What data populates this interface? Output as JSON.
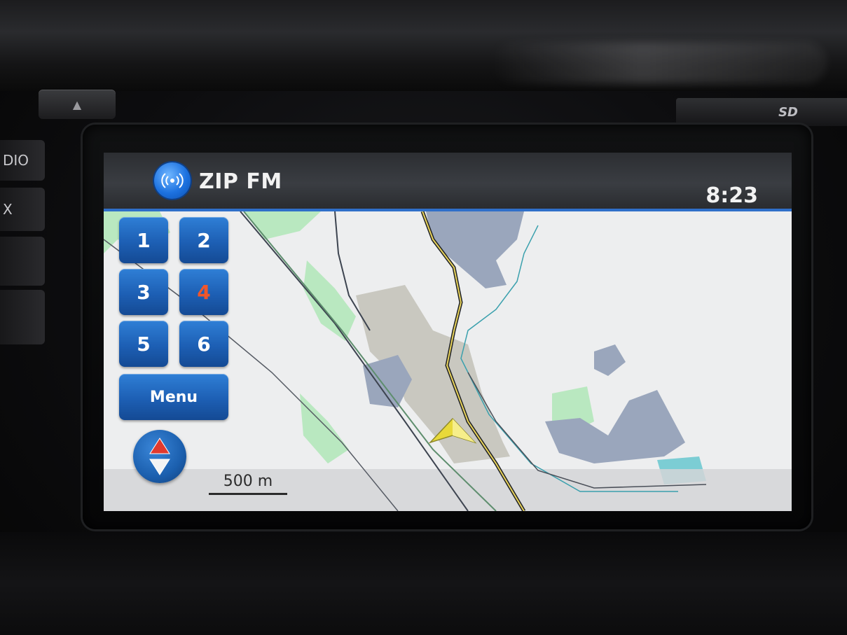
{
  "colors": {
    "accent_blue": "#2f6fc9",
    "preset_button": "#1d5fb4",
    "active_preset_text": "#f0562b",
    "map_background": "#edeeef",
    "map_park": "#b9e8c0",
    "map_building": "#9aa6bc",
    "map_industrial": "#c9c8c0",
    "position_arrow": "#f3e34a"
  },
  "hardware": {
    "eject_icon": "eject-icon",
    "sd_label": "SD",
    "side_labels": [
      "DIO",
      "X"
    ]
  },
  "status_bar": {
    "source_icon": "radio-broadcast-icon",
    "station_name": "ZIP FM",
    "time": "8:23"
  },
  "presets": [
    {
      "label": "1",
      "active": false
    },
    {
      "label": "2",
      "active": false
    },
    {
      "label": "3",
      "active": false
    },
    {
      "label": "4",
      "active": true
    },
    {
      "label": "5",
      "active": false
    },
    {
      "label": "6",
      "active": false
    }
  ],
  "menu_label": "Menu",
  "zoom_icon": "zoom-up-down-icon",
  "map": {
    "scale_label": "500 m",
    "position_marker_icon": "vehicle-position-arrow-icon"
  }
}
